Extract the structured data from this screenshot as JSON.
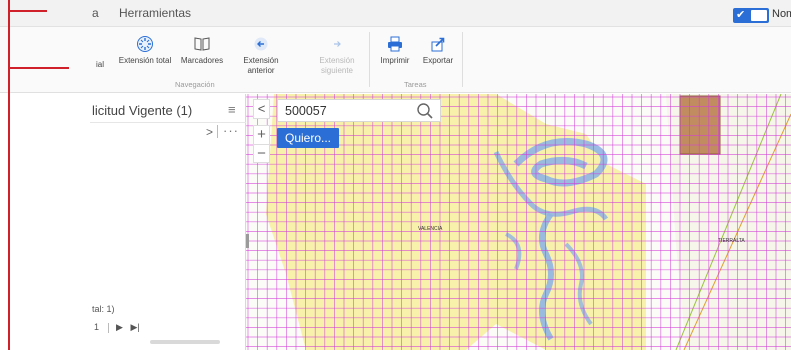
{
  "menubar": {
    "items": [
      "a",
      "Herramientas"
    ],
    "toggle_label": "Nom"
  },
  "ribbon": {
    "buttons": {
      "initial": "ial",
      "full_extent": "Extensión total",
      "bookmarks": "Marcadores",
      "prev_extent_line1": "Extensión",
      "prev_extent_line2": "anterior",
      "next_extent_line1": "Extensión",
      "next_extent_line2": "siguiente",
      "print": "Imprimir",
      "export": "Exportar"
    },
    "groups": {
      "navigation": "Navegación",
      "tasks": "Tareas"
    }
  },
  "panel": {
    "title": "licitud Vigente (1)",
    "menu_icon": "≡",
    "chevron": ">",
    "dots": "···",
    "total": "tal: 1)",
    "pager_page": "1"
  },
  "map": {
    "collapse": "<",
    "zoom_in": "+",
    "zoom_out": "−",
    "search_value": "500057",
    "quiero_label": "Quiero...",
    "labels": {
      "valencia": "VALENCIA",
      "tierralta": "TIERRALTA"
    },
    "colors": {
      "grid": "#d23bd8",
      "highlight": "#f7ef9e",
      "water": "#8fb4e3",
      "parcel": "#c0875a"
    }
  }
}
